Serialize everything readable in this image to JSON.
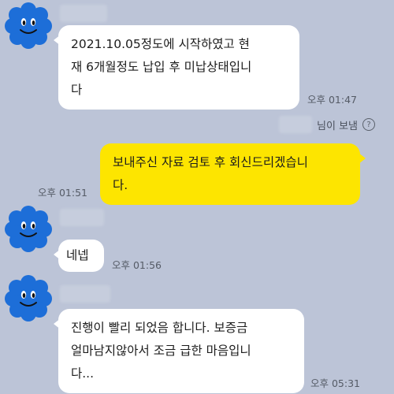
{
  "messages": [
    {
      "direction": "incoming",
      "lines": [
        "2021.10.05정도에 시작하였고 현",
        "재 6개월정도 납입 후 미납상태입니",
        "다"
      ],
      "time": "오후 01:47"
    },
    {
      "direction": "outgoing",
      "sender_label": "님이 보냄",
      "lines": [
        "보내주신 자료 검토 후 회신드리겠습니",
        "다."
      ],
      "time": "오후 01:51"
    },
    {
      "direction": "incoming",
      "lines": [
        "네넵"
      ],
      "time": "오후 01:56"
    },
    {
      "direction": "incoming",
      "lines": [
        "진행이 빨리 되었음 합니다. 보증금",
        "얼마남지않아서 조금 급한 마음입니",
        "다..."
      ],
      "time": "오후 05:31"
    }
  ],
  "icons": {
    "avatar": "blue-cloud-smiley-icon",
    "help": "question-circle-icon"
  },
  "colors": {
    "background": "#bcc4d7",
    "incoming_bubble": "#ffffff",
    "outgoing_bubble": "#fde500",
    "avatar": "#1d6ed8"
  }
}
